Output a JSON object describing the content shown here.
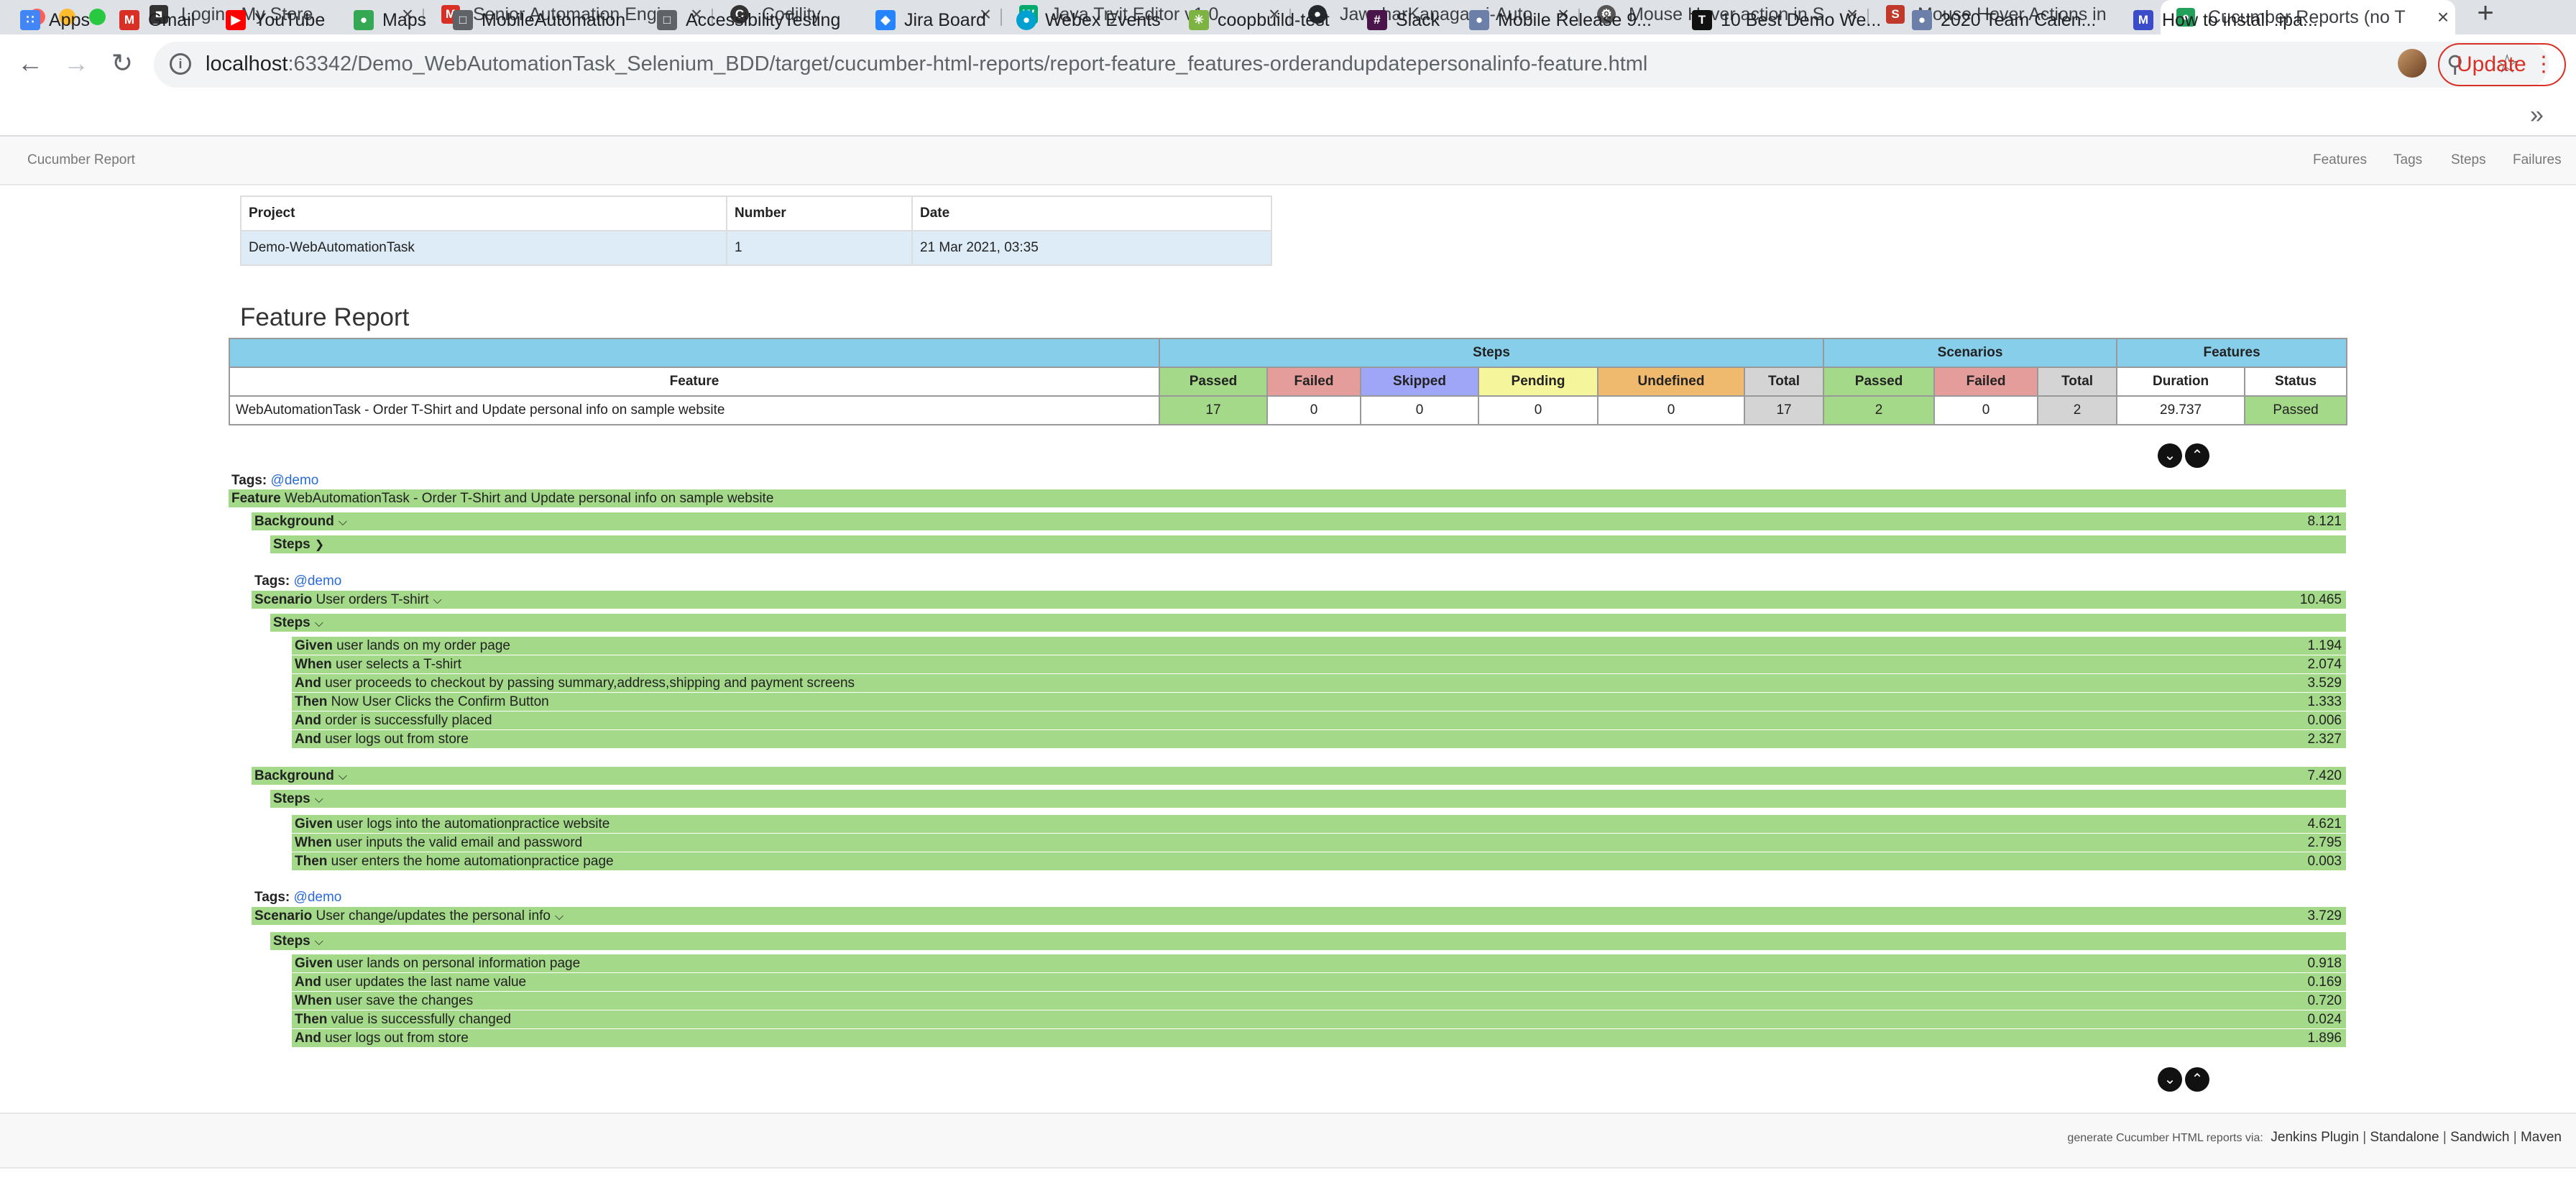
{
  "browser": {
    "tabs": [
      {
        "title": "Login - My Store",
        "icon": "store-icon",
        "color": "#333333"
      },
      {
        "title": "Senior Automation Engi",
        "icon": "gmail-icon",
        "color": "#d93025"
      },
      {
        "title": "Codility",
        "icon": "codility-icon",
        "color": "#333333"
      },
      {
        "title": "Java Tryit Editor v1.0",
        "icon": "w3schools-icon",
        "color": "#04aa6d"
      },
      {
        "title": "JawaharKanagaraj-Auto",
        "icon": "github-icon",
        "color": "#24292e"
      },
      {
        "title": "Mouse Hover action in S",
        "icon": "gear-icon",
        "color": "#555555"
      },
      {
        "title": "Mouse Hover Actions in",
        "icon": "page-icon",
        "color": "#c0392b"
      },
      {
        "title": "Cucumber Reports (no T",
        "icon": "cucumber-icon",
        "color": "#23a05a"
      }
    ],
    "url_host": "localhost",
    "url_path": ":63342/Demo_WebAutomationTask_Selenium_BDD/target/cucumber-html-reports/report-feature_features-orderandupdatepersonalinfo-feature.html",
    "update_label": "Update",
    "bookmarks": [
      {
        "label": "Apps",
        "icon": "apps-grid-icon",
        "color": "#4285f4"
      },
      {
        "label": "Gmail",
        "icon": "gmail-icon",
        "color": "#d93025"
      },
      {
        "label": "YouTube",
        "icon": "youtube-icon",
        "color": "#ff0000"
      },
      {
        "label": "Maps",
        "icon": "maps-icon",
        "color": "#34a853"
      },
      {
        "label": "MobileAutomation",
        "icon": "folder-icon",
        "color": "#5f6368"
      },
      {
        "label": "AccessibilityTesting",
        "icon": "folder-icon",
        "color": "#5f6368"
      },
      {
        "label": "Jira Board",
        "icon": "jira-icon",
        "color": "#2684ff"
      },
      {
        "label": "Webex Events",
        "icon": "webex-icon",
        "color": "#00a0d1"
      },
      {
        "label": "coopbuild-test",
        "icon": "coop-icon",
        "color": "#7cb342"
      },
      {
        "label": "Slack",
        "icon": "slack-icon",
        "color": "#4a154b"
      },
      {
        "label": "Mobile Release 9...",
        "icon": "release-icon",
        "color": "#6b7fa8"
      },
      {
        "label": "10 Best Demo We...",
        "icon": "t-icon",
        "color": "#111111"
      },
      {
        "label": "2020 Team Calen...",
        "icon": "calendar-icon",
        "color": "#6b7fa8"
      },
      {
        "label": "How to install .ipa...",
        "icon": "ipa-icon",
        "color": "#3b4cca"
      }
    ]
  },
  "report": {
    "brand": "Cucumber Report",
    "nav": [
      "Features",
      "Tags",
      "Steps",
      "Failures"
    ],
    "project_table": {
      "headers": [
        "Project",
        "Number",
        "Date"
      ],
      "row": [
        "Demo-WebAutomationTask",
        "1",
        "21 Mar 2021, 03:35"
      ]
    },
    "feature_report_title": "Feature Report",
    "feature_table": {
      "group_headers": {
        "steps": "Steps",
        "scenarios": "Scenarios",
        "features": "Features"
      },
      "col_headers": [
        "Feature",
        "Passed",
        "Failed",
        "Skipped",
        "Pending",
        "Undefined",
        "Total",
        "Passed",
        "Failed",
        "Total",
        "Duration",
        "Status"
      ],
      "row": [
        "WebAutomationTask - Order T-Shirt and Update personal info on sample website",
        "17",
        "0",
        "0",
        "0",
        "0",
        "17",
        "2",
        "0",
        "2",
        "29.737",
        "Passed"
      ]
    },
    "feature": {
      "tags_label": "Tags:",
      "tag": "@demo",
      "keyword": "Feature",
      "name": "WebAutomationTask - Order T-Shirt and Update personal info on sample website",
      "background1": {
        "keyword": "Background",
        "duration": "8.121",
        "steps_label": "Steps"
      },
      "scenario1": {
        "tags_label": "Tags:",
        "tag": "@demo",
        "keyword": "Scenario",
        "name": "User orders T-shirt",
        "duration": "10.465",
        "steps_label": "Steps",
        "steps": [
          {
            "kw": "Given",
            "text": "user lands on my order page",
            "dur": "1.194"
          },
          {
            "kw": "When",
            "text": "user selects a T-shirt",
            "dur": "2.074"
          },
          {
            "kw": "And",
            "text": "user proceeds to checkout by passing summary,address,shipping and payment screens",
            "dur": "3.529"
          },
          {
            "kw": "Then",
            "text": "Now User Clicks the Confirm Button",
            "dur": "1.333"
          },
          {
            "kw": "And",
            "text": "order is successfully placed",
            "dur": "0.006"
          },
          {
            "kw": "And",
            "text": "user logs out from store",
            "dur": "2.327"
          }
        ]
      },
      "background2": {
        "keyword": "Background",
        "duration": "7.420",
        "steps_label": "Steps",
        "steps": [
          {
            "kw": "Given",
            "text": "user logs into the automationpractice website",
            "dur": "4.621"
          },
          {
            "kw": "When",
            "text": "user inputs the valid email and password",
            "dur": "2.795"
          },
          {
            "kw": "Then",
            "text": "user enters the home automationpractice page",
            "dur": "0.003"
          }
        ]
      },
      "scenario2": {
        "tags_label": "Tags:",
        "tag": "@demo",
        "keyword": "Scenario",
        "name": "User change/updates the personal info",
        "duration": "3.729",
        "steps_label": "Steps",
        "steps": [
          {
            "kw": "Given",
            "text": "user lands on personal information page",
            "dur": "0.918"
          },
          {
            "kw": "And",
            "text": "user updates the last name value",
            "dur": "0.169"
          },
          {
            "kw": "When",
            "text": "user save the changes",
            "dur": "0.720"
          },
          {
            "kw": "Then",
            "text": "value is successfully changed",
            "dur": "0.024"
          },
          {
            "kw": "And",
            "text": "user logs out from store",
            "dur": "1.896"
          }
        ]
      }
    },
    "footer": {
      "prefix": "generate Cucumber HTML reports via:",
      "links": [
        "Jenkins Plugin",
        "Standalone",
        "Sandwich",
        "Maven"
      ],
      "sep": "|"
    }
  }
}
